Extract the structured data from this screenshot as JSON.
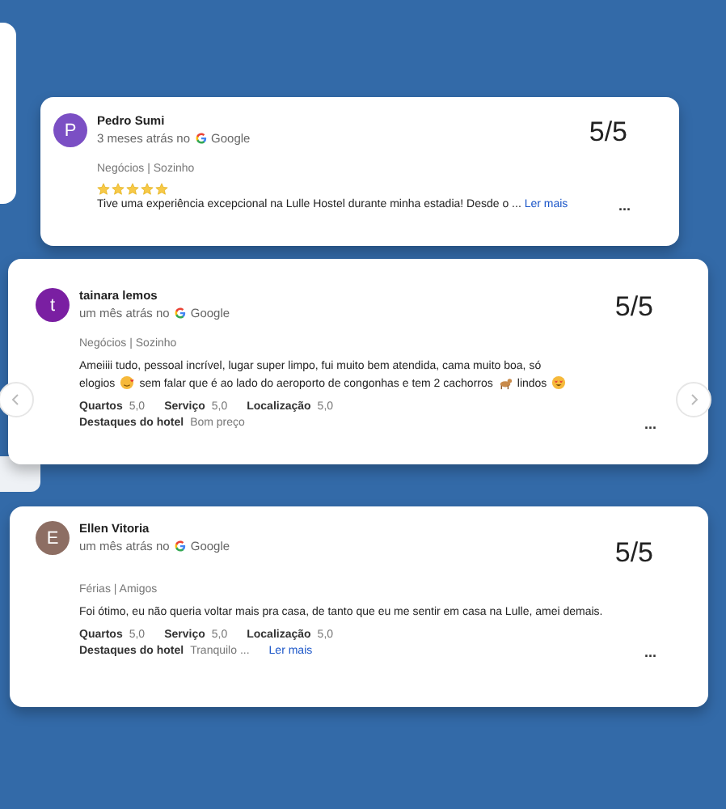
{
  "reviews": [
    {
      "avatar": "P",
      "color": "#7b4fc4",
      "name": "Pedro Sumi",
      "time": "3 meses atrás no",
      "source": "Google",
      "score": "5/5",
      "trip": "Negócios | Sozinho",
      "stars": 5,
      "body": [
        {
          "kind": "text",
          "text": "Tive uma experiência excepcional na Lulle Hostel durante minha estadia! Desde o ..."
        }
      ],
      "more_link": "Ler mais",
      "menu": "..."
    },
    {
      "avatar": "t",
      "color": "#7a1fa2",
      "name": "tainara lemos",
      "time": "um mês atrás no",
      "source": "Google",
      "score": "5/5",
      "trip": "Negócios | Sozinho",
      "body": [
        {
          "kind": "text",
          "text": "Ameiiii tudo, pessoal incrível, lugar super limpo, fui muito bem atendida, cama muito boa, só"
        },
        {
          "kind": "break"
        },
        {
          "kind": "text",
          "text": "elogios"
        },
        {
          "kind": "hearts"
        },
        {
          "kind": "text",
          "text": "sem falar que é ao lado do aeroporto de congonhas e tem 2 cachorros"
        },
        {
          "kind": "dogs"
        },
        {
          "kind": "text",
          "text": "lindos"
        },
        {
          "kind": "hearteyes"
        }
      ],
      "ratings": [
        {
          "label": "Quartos",
          "value": "5,0"
        },
        {
          "label": "Serviço",
          "value": "5,0"
        },
        {
          "label": "Localização",
          "value": "5,0"
        }
      ],
      "highlights": {
        "label": "Destaques do hotel",
        "value": "Bom preço"
      },
      "menu": "...",
      "carousel": true
    },
    {
      "avatar": "E",
      "color": "#8d6e63",
      "name": "Ellen Vitoria",
      "time": "um mês atrás no",
      "source": "Google",
      "score": "5/5",
      "trip": "Férias | Amigos",
      "body": [
        {
          "kind": "text",
          "text": "Foi ótimo, eu não queria voltar mais pra casa, de tanto que eu me sentir em casa na Lulle, amei demais."
        }
      ],
      "ratings": [
        {
          "label": "Quartos",
          "value": "5,0"
        },
        {
          "label": "Serviço",
          "value": "5,0"
        },
        {
          "label": "Localização",
          "value": "5,0"
        }
      ],
      "highlights": {
        "label": "Destaques do hotel",
        "value": "Tranquilo ..."
      },
      "highlight_link": "Ler mais",
      "menu": "..."
    }
  ]
}
